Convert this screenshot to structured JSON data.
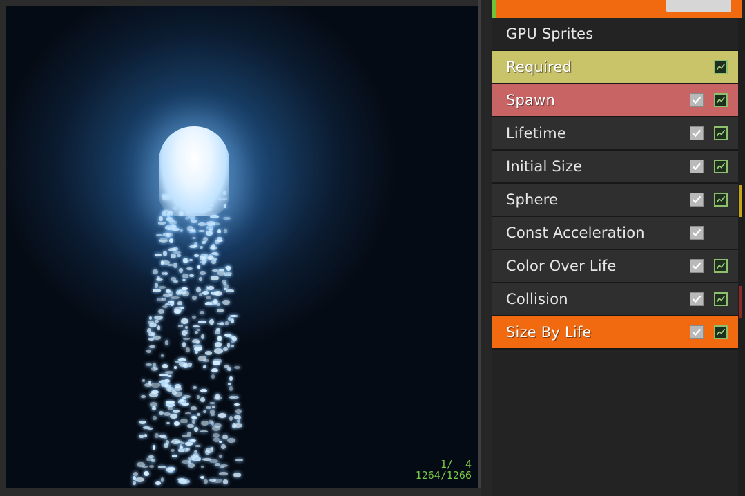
{
  "viewport": {
    "stats_line1": "1/  4",
    "stats_line2": "1264/1266"
  },
  "emitter": {
    "name": "GPU Sprites"
  },
  "modules": [
    {
      "label": "Required",
      "type": "required",
      "has_enable_toggle": false,
      "has_curve_toggle": true
    },
    {
      "label": "Spawn",
      "type": "spawn",
      "has_enable_toggle": true,
      "has_curve_toggle": true
    },
    {
      "label": "Lifetime",
      "type": "normal",
      "has_enable_toggle": true,
      "has_curve_toggle": true
    },
    {
      "label": "Initial Size",
      "type": "normal",
      "has_enable_toggle": true,
      "has_curve_toggle": true
    },
    {
      "label": "Sphere",
      "type": "normal",
      "has_enable_toggle": true,
      "has_curve_toggle": true
    },
    {
      "label": "Const Acceleration",
      "type": "normal",
      "has_enable_toggle": true,
      "has_curve_toggle": false
    },
    {
      "label": "Color Over Life",
      "type": "normal",
      "has_enable_toggle": true,
      "has_curve_toggle": true
    },
    {
      "label": "Collision",
      "type": "normal",
      "has_enable_toggle": true,
      "has_curve_toggle": true
    },
    {
      "label": "Size By Life",
      "type": "selected",
      "has_enable_toggle": true,
      "has_curve_toggle": true
    }
  ],
  "colors": {
    "emitter_header_accent": "#f26a10",
    "required_module": "#c9c36a",
    "spawn_module": "#c86464",
    "selected_module": "#f26a10",
    "stats_text": "#7ac943"
  }
}
